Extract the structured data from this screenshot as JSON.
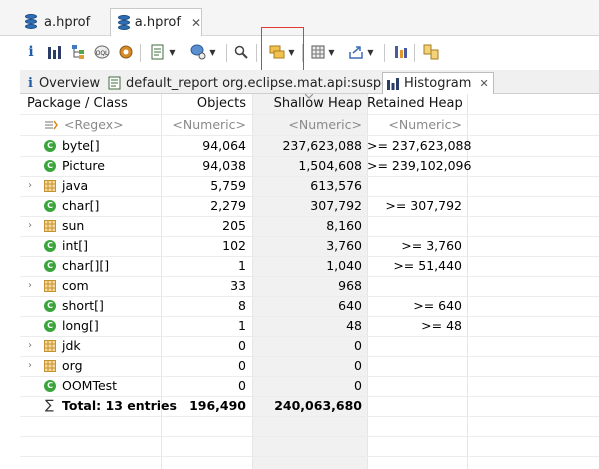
{
  "editor_tabs": [
    {
      "label": "a.hprof",
      "active": false
    },
    {
      "label": "a.hprof",
      "active": true,
      "close": "✕"
    }
  ],
  "inner_tabs": [
    {
      "label": "Overview",
      "icon": "info-icon"
    },
    {
      "label": "default_report  org.eclipse.mat.api:suspects",
      "icon": "report-icon"
    },
    {
      "label": "Histogram",
      "icon": "histogram-icon",
      "active": true,
      "close": "✕"
    }
  ],
  "table": {
    "headers": [
      "Package / Class",
      "Objects",
      "Shallow Heap",
      "Retained Heap"
    ],
    "filter": {
      "name": "<Regex>",
      "objects": "<Numeric>",
      "shallow": "<Numeric>",
      "retained": "<Numeric>"
    },
    "rows": [
      {
        "kind": "class",
        "expand": false,
        "name": "byte[]",
        "objects": "94,064",
        "shallow": "237,623,088",
        "retained": ">= 237,623,088"
      },
      {
        "kind": "class",
        "expand": false,
        "name": "Picture",
        "objects": "94,038",
        "shallow": "1,504,608",
        "retained": ">= 239,102,096"
      },
      {
        "kind": "package",
        "expand": true,
        "name": "java",
        "objects": "5,759",
        "shallow": "613,576",
        "retained": ""
      },
      {
        "kind": "class",
        "expand": false,
        "name": "char[]",
        "objects": "2,279",
        "shallow": "307,792",
        "retained": ">= 307,792"
      },
      {
        "kind": "package",
        "expand": true,
        "name": "sun",
        "objects": "205",
        "shallow": "8,160",
        "retained": ""
      },
      {
        "kind": "class",
        "expand": false,
        "name": "int[]",
        "objects": "102",
        "shallow": "3,760",
        "retained": ">= 3,760"
      },
      {
        "kind": "class",
        "expand": false,
        "name": "char[][]",
        "objects": "1",
        "shallow": "1,040",
        "retained": ">= 51,440"
      },
      {
        "kind": "package",
        "expand": true,
        "name": "com",
        "objects": "33",
        "shallow": "968",
        "retained": ""
      },
      {
        "kind": "class",
        "expand": false,
        "name": "short[]",
        "objects": "8",
        "shallow": "640",
        "retained": ">= 640"
      },
      {
        "kind": "class",
        "expand": false,
        "name": "long[]",
        "objects": "1",
        "shallow": "48",
        "retained": ">= 48"
      },
      {
        "kind": "package",
        "expand": true,
        "name": "jdk",
        "objects": "0",
        "shallow": "0",
        "retained": ""
      },
      {
        "kind": "package",
        "expand": true,
        "name": "org",
        "objects": "0",
        "shallow": "0",
        "retained": ""
      },
      {
        "kind": "class",
        "expand": false,
        "name": "OOMTest",
        "objects": "0",
        "shallow": "0",
        "retained": ""
      }
    ],
    "total": {
      "symbol": "∑",
      "label": "Total: 13 entries",
      "objects": "196,490",
      "shallow": "240,063,680",
      "retained": ""
    }
  },
  "colors": {
    "class_icon": "#3aa53a",
    "package_icon": "#c8912f",
    "highlight": "#e53935",
    "accent": "#2f6fb5"
  }
}
